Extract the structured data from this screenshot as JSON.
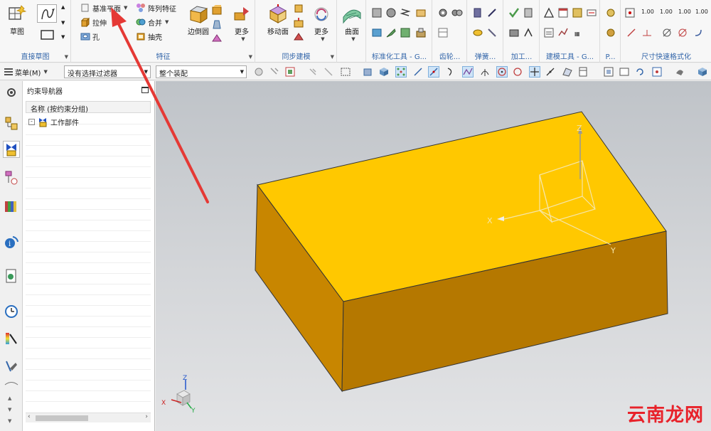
{
  "ribbon": {
    "sketch_group": {
      "label": "直接草图",
      "sketch_btn": "草图"
    },
    "feature_group": {
      "label": "特征",
      "datum_plane": "基准平面",
      "extrude": "拉伸",
      "hole": "孔",
      "pattern": "阵列特征",
      "unite": "合并",
      "shell": "抽壳",
      "edge_blend": "边倒圆",
      "more": "更多"
    },
    "sync_group": {
      "label": "同步建模",
      "move_face": "移动面",
      "more": "更多"
    },
    "surface_group": {
      "surface": "曲面"
    },
    "standard_tools": {
      "label": "标准化工具 - G..."
    },
    "gear": {
      "label": "齿轮..."
    },
    "spring": {
      "label": "弹簧..."
    },
    "machining": {
      "label": "加工..."
    },
    "modeling_tools": {
      "label": "建模工具 - G..."
    },
    "misc": {
      "label": "P..."
    },
    "dim_quick": {
      "label": "尺寸快速格式化",
      "v1": "1.00",
      "v2": "1.00",
      "v3": "1.00",
      "v4": "1.00"
    }
  },
  "toolbar": {
    "menu_label": "菜单(M)",
    "filter_value": "没有选择过滤器",
    "assembly_value": "整个装配"
  },
  "navigator": {
    "title": "约束导航器",
    "column_header": "名称 (按约束分组)",
    "tree_item": "工作部件"
  },
  "viewport": {
    "axis_labels": {
      "x": "X",
      "y": "Y",
      "z": "Z"
    },
    "triad_labels": {
      "x": "X",
      "y": "Y",
      "z": "Z"
    },
    "colors": {
      "top_face": "#ffc800",
      "front_face": "#b57800",
      "side_face": "#c88600"
    }
  },
  "watermark": "云南龙网",
  "annotation_color": "#e53935"
}
